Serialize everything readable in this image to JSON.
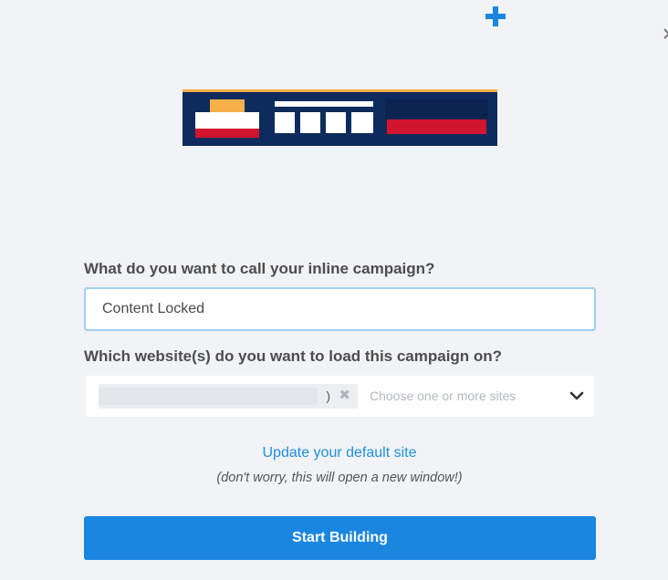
{
  "header": {
    "add_icon": "plus-icon",
    "accent_color": "#1a86e0"
  },
  "banner": {
    "colors": {
      "navy": "#0d2b5c",
      "orange": "#f5b04a",
      "red": "#d2152f",
      "white": "#ffffff"
    }
  },
  "form": {
    "name_question": "What do you want to call your inline campaign?",
    "name_value": "Content Locked",
    "sites_question": "Which website(s) do you want to load this campaign on?",
    "selected_site_suffix": ")",
    "remove_icon": "close-icon",
    "sites_placeholder": "Choose one or more sites",
    "dropdown_icon": "chevron-down-icon"
  },
  "links": {
    "update_default_site": "Update your default site",
    "new_window_note": "(don't worry, this will open a new window!)"
  },
  "actions": {
    "start_label": "Start Building"
  }
}
